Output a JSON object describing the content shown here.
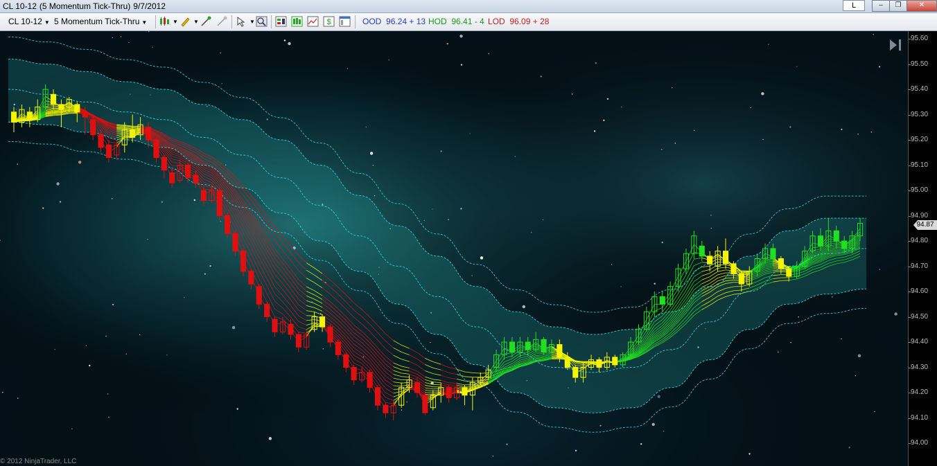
{
  "window": {
    "symbol": "CL 10-12",
    "period": "(5 Momentum Tick-Thru)",
    "date": "9/7/2012",
    "l_button": "L",
    "minimize": "–",
    "restore": "❐",
    "close": "✕"
  },
  "toolbar": {
    "instrument": "CL 10-12",
    "interval": "5 Momentum Tick-Thru",
    "ood_label": "OOD",
    "ood_value": "96.24 + 13",
    "hod_label": "HOD",
    "hod_value": "96.41 - 4",
    "lod_label": "LOD",
    "lod_value": "96.09 + 28",
    "colors": {
      "ood": "#1e3fd0",
      "hod": "#1a9a1a",
      "lod": "#d01a1a"
    }
  },
  "icons": [
    "bar-type-icon",
    "pencil-drawing-icon",
    "pin-tool-icon",
    "remove-tool-icon",
    "pointer-icon",
    "zoom-icon",
    "chart-trader-icon",
    "data-box-icon",
    "indicators-icon",
    "strategies-icon",
    "properties-icon",
    "scroll-end-icon"
  ],
  "price_axis": {
    "ticks": [
      "95.60",
      "95.50",
      "95.40",
      "95.30",
      "95.20",
      "95.10",
      "95.00",
      "94.90",
      "94.80",
      "94.70",
      "94.60",
      "94.50",
      "94.40",
      "94.30",
      "94.20",
      "94.10",
      "94.00"
    ],
    "last_price": "94.87"
  },
  "copyright": "© 2012 NinjaTrader, LLC",
  "chart_data": {
    "type": "candlestick",
    "ylim": [
      93.97,
      95.62
    ],
    "colors": {
      "up": "#20e020",
      "neutral": "#f5f500",
      "down": "#e01010",
      "band": "#30d0d8",
      "fill": "#208080"
    },
    "candles": [
      {
        "o": 95.31,
        "c": 95.27,
        "h": 95.33,
        "l": 95.23,
        "col": "neutral"
      },
      {
        "o": 95.27,
        "c": 95.32,
        "h": 95.34,
        "l": 95.25,
        "col": "neutral"
      },
      {
        "o": 95.31,
        "c": 95.28,
        "h": 95.33,
        "l": 95.25,
        "col": "neutral"
      },
      {
        "o": 95.28,
        "c": 95.33,
        "h": 95.36,
        "l": 95.27,
        "col": "neutral"
      },
      {
        "o": 95.33,
        "c": 95.4,
        "h": 95.42,
        "l": 95.32,
        "col": "up"
      },
      {
        "o": 95.38,
        "c": 95.34,
        "h": 95.4,
        "l": 95.32,
        "col": "neutral"
      },
      {
        "o": 95.34,
        "c": 95.32,
        "h": 95.36,
        "l": 95.25,
        "col": "neutral"
      },
      {
        "o": 95.33,
        "c": 95.36,
        "h": 95.37,
        "l": 95.31,
        "col": "neutral"
      },
      {
        "o": 95.34,
        "c": 95.31,
        "h": 95.35,
        "l": 95.27,
        "col": "neutral"
      },
      {
        "o": 95.31,
        "c": 95.29,
        "h": 95.33,
        "l": 95.22,
        "col": "down"
      },
      {
        "o": 95.28,
        "c": 95.22,
        "h": 95.3,
        "l": 95.2,
        "col": "down"
      },
      {
        "o": 95.22,
        "c": 95.17,
        "h": 95.24,
        "l": 95.15,
        "col": "down"
      },
      {
        "o": 95.18,
        "c": 95.13,
        "h": 95.2,
        "l": 95.11,
        "col": "down"
      },
      {
        "o": 95.14,
        "c": 95.18,
        "h": 95.2,
        "l": 95.12,
        "col": "down"
      },
      {
        "o": 95.18,
        "c": 95.24,
        "h": 95.27,
        "l": 95.15,
        "col": "neutral"
      },
      {
        "o": 95.24,
        "c": 95.21,
        "h": 95.3,
        "l": 95.19,
        "col": "neutral"
      },
      {
        "o": 95.22,
        "c": 95.26,
        "h": 95.29,
        "l": 95.2,
        "col": "neutral"
      },
      {
        "o": 95.25,
        "c": 95.2,
        "h": 95.27,
        "l": 95.17,
        "col": "down"
      },
      {
        "o": 95.2,
        "c": 95.13,
        "h": 95.21,
        "l": 95.11,
        "col": "down"
      },
      {
        "o": 95.13,
        "c": 95.08,
        "h": 95.14,
        "l": 95.05,
        "col": "down"
      },
      {
        "o": 95.07,
        "c": 95.03,
        "h": 95.09,
        "l": 95.01,
        "col": "down"
      },
      {
        "o": 95.04,
        "c": 95.1,
        "h": 95.12,
        "l": 95.03,
        "col": "down"
      },
      {
        "o": 95.1,
        "c": 95.05,
        "h": 95.11,
        "l": 95.03,
        "col": "down"
      },
      {
        "o": 95.06,
        "c": 95.03,
        "h": 95.08,
        "l": 95.01,
        "col": "down"
      },
      {
        "o": 95.0,
        "c": 94.96,
        "h": 95.02,
        "l": 94.94,
        "col": "down"
      },
      {
        "o": 94.96,
        "c": 95.0,
        "h": 95.02,
        "l": 94.95,
        "col": "down"
      },
      {
        "o": 95.0,
        "c": 94.9,
        "h": 95.01,
        "l": 94.88,
        "col": "down"
      },
      {
        "o": 94.9,
        "c": 94.83,
        "h": 94.91,
        "l": 94.81,
        "col": "down"
      },
      {
        "o": 94.83,
        "c": 94.76,
        "h": 94.84,
        "l": 94.74,
        "col": "down"
      },
      {
        "o": 94.76,
        "c": 94.68,
        "h": 94.77,
        "l": 94.66,
        "col": "down"
      },
      {
        "o": 94.68,
        "c": 94.63,
        "h": 94.69,
        "l": 94.61,
        "col": "down"
      },
      {
        "o": 94.62,
        "c": 94.55,
        "h": 94.63,
        "l": 94.53,
        "col": "down"
      },
      {
        "o": 94.55,
        "c": 94.5,
        "h": 94.56,
        "l": 94.48,
        "col": "down"
      },
      {
        "o": 94.49,
        "c": 94.44,
        "h": 94.5,
        "l": 94.42,
        "col": "down"
      },
      {
        "o": 94.44,
        "c": 94.48,
        "h": 94.5,
        "l": 94.43,
        "col": "down"
      },
      {
        "o": 94.47,
        "c": 94.43,
        "h": 94.49,
        "l": 94.41,
        "col": "down"
      },
      {
        "o": 94.43,
        "c": 94.38,
        "h": 94.44,
        "l": 94.36,
        "col": "down"
      },
      {
        "o": 94.38,
        "c": 94.43,
        "h": 94.45,
        "l": 94.37,
        "col": "down"
      },
      {
        "o": 94.45,
        "c": 94.5,
        "h": 94.52,
        "l": 94.44,
        "col": "neutral"
      },
      {
        "o": 94.5,
        "c": 94.46,
        "h": 94.51,
        "l": 94.44,
        "col": "neutral"
      },
      {
        "o": 94.46,
        "c": 94.4,
        "h": 94.47,
        "l": 94.38,
        "col": "down"
      },
      {
        "o": 94.4,
        "c": 94.35,
        "h": 94.41,
        "l": 94.33,
        "col": "down"
      },
      {
        "o": 94.35,
        "c": 94.3,
        "h": 94.36,
        "l": 94.28,
        "col": "down"
      },
      {
        "o": 94.3,
        "c": 94.25,
        "h": 94.31,
        "l": 94.23,
        "col": "down"
      },
      {
        "o": 94.25,
        "c": 94.28,
        "h": 94.3,
        "l": 94.24,
        "col": "down"
      },
      {
        "o": 94.28,
        "c": 94.22,
        "h": 94.29,
        "l": 94.2,
        "col": "down"
      },
      {
        "o": 94.22,
        "c": 94.15,
        "h": 94.23,
        "l": 94.13,
        "col": "down"
      },
      {
        "o": 94.15,
        "c": 94.12,
        "h": 94.16,
        "l": 94.1,
        "col": "down"
      },
      {
        "o": 94.12,
        "c": 94.15,
        "h": 94.17,
        "l": 94.09,
        "col": "down"
      },
      {
        "o": 94.15,
        "c": 94.22,
        "h": 94.24,
        "l": 94.14,
        "col": "neutral"
      },
      {
        "o": 94.22,
        "c": 94.25,
        "h": 94.27,
        "l": 94.2,
        "col": "neutral"
      },
      {
        "o": 94.24,
        "c": 94.2,
        "h": 94.26,
        "l": 94.18,
        "col": "down"
      },
      {
        "o": 94.19,
        "c": 94.12,
        "h": 94.2,
        "l": 94.11,
        "col": "down"
      },
      {
        "o": 94.14,
        "c": 94.19,
        "h": 94.21,
        "l": 94.13,
        "col": "neutral"
      },
      {
        "o": 94.19,
        "c": 94.22,
        "h": 94.24,
        "l": 94.16,
        "col": "neutral"
      },
      {
        "o": 94.22,
        "c": 94.18,
        "h": 94.23,
        "l": 94.16,
        "col": "down"
      },
      {
        "o": 94.18,
        "c": 94.22,
        "h": 94.24,
        "l": 94.17,
        "col": "down"
      },
      {
        "o": 94.22,
        "c": 94.19,
        "h": 94.23,
        "l": 94.15,
        "col": "neutral"
      },
      {
        "o": 94.19,
        "c": 94.24,
        "h": 94.26,
        "l": 94.13,
        "col": "neutral"
      },
      {
        "o": 94.24,
        "c": 94.26,
        "h": 94.28,
        "l": 94.23,
        "col": "neutral"
      },
      {
        "o": 94.26,
        "c": 94.29,
        "h": 94.31,
        "l": 94.25,
        "col": "neutral"
      },
      {
        "o": 94.3,
        "c": 94.35,
        "h": 94.37,
        "l": 94.28,
        "col": "up"
      },
      {
        "o": 94.35,
        "c": 94.4,
        "h": 94.42,
        "l": 94.33,
        "col": "up"
      },
      {
        "o": 94.4,
        "c": 94.36,
        "h": 94.42,
        "l": 94.34,
        "col": "up"
      },
      {
        "o": 94.36,
        "c": 94.4,
        "h": 94.42,
        "l": 94.34,
        "col": "up"
      },
      {
        "o": 94.4,
        "c": 94.37,
        "h": 94.42,
        "l": 94.35,
        "col": "up"
      },
      {
        "o": 94.37,
        "c": 94.41,
        "h": 94.44,
        "l": 94.36,
        "col": "up"
      },
      {
        "o": 94.41,
        "c": 94.36,
        "h": 94.42,
        "l": 94.35,
        "col": "up"
      },
      {
        "o": 94.36,
        "c": 94.39,
        "h": 94.41,
        "l": 94.35,
        "col": "up"
      },
      {
        "o": 94.39,
        "c": 94.34,
        "h": 94.41,
        "l": 94.32,
        "col": "neutral"
      },
      {
        "o": 94.34,
        "c": 94.3,
        "h": 94.36,
        "l": 94.29,
        "col": "neutral"
      },
      {
        "o": 94.3,
        "c": 94.26,
        "h": 94.31,
        "l": 94.24,
        "col": "neutral"
      },
      {
        "o": 94.26,
        "c": 94.3,
        "h": 94.32,
        "l": 94.24,
        "col": "neutral"
      },
      {
        "o": 94.3,
        "c": 94.33,
        "h": 94.35,
        "l": 94.29,
        "col": "neutral"
      },
      {
        "o": 94.33,
        "c": 94.3,
        "h": 94.34,
        "l": 94.28,
        "col": "neutral"
      },
      {
        "o": 94.3,
        "c": 94.34,
        "h": 94.36,
        "l": 94.29,
        "col": "neutral"
      },
      {
        "o": 94.34,
        "c": 94.31,
        "h": 94.35,
        "l": 94.3,
        "col": "neutral"
      },
      {
        "o": 94.31,
        "c": 94.35,
        "h": 94.36,
        "l": 94.3,
        "col": "up"
      },
      {
        "o": 94.35,
        "c": 94.4,
        "h": 94.42,
        "l": 94.34,
        "col": "up"
      },
      {
        "o": 94.4,
        "c": 94.45,
        "h": 94.47,
        "l": 94.39,
        "col": "up"
      },
      {
        "o": 94.45,
        "c": 94.52,
        "h": 94.54,
        "l": 94.44,
        "col": "up"
      },
      {
        "o": 94.52,
        "c": 94.58,
        "h": 94.6,
        "l": 94.5,
        "col": "up"
      },
      {
        "o": 94.58,
        "c": 94.55,
        "h": 94.6,
        "l": 94.52,
        "col": "up"
      },
      {
        "o": 94.55,
        "c": 94.62,
        "h": 94.64,
        "l": 94.54,
        "col": "up"
      },
      {
        "o": 94.62,
        "c": 94.69,
        "h": 94.71,
        "l": 94.6,
        "col": "up"
      },
      {
        "o": 94.69,
        "c": 94.75,
        "h": 94.77,
        "l": 94.67,
        "col": "up"
      },
      {
        "o": 94.75,
        "c": 94.82,
        "h": 94.84,
        "l": 94.73,
        "col": "up"
      },
      {
        "o": 94.78,
        "c": 94.74,
        "h": 94.8,
        "l": 94.72,
        "col": "up"
      },
      {
        "o": 94.74,
        "c": 94.71,
        "h": 94.76,
        "l": 94.68,
        "col": "neutral"
      },
      {
        "o": 94.7,
        "c": 94.76,
        "h": 94.78,
        "l": 94.68,
        "col": "neutral"
      },
      {
        "o": 94.76,
        "c": 94.71,
        "h": 94.81,
        "l": 94.69,
        "col": "neutral"
      },
      {
        "o": 94.71,
        "c": 94.67,
        "h": 94.72,
        "l": 94.65,
        "col": "neutral"
      },
      {
        "o": 94.67,
        "c": 94.63,
        "h": 94.68,
        "l": 94.6,
        "col": "neutral"
      },
      {
        "o": 94.63,
        "c": 94.68,
        "h": 94.7,
        "l": 94.62,
        "col": "neutral"
      },
      {
        "o": 94.68,
        "c": 94.73,
        "h": 94.75,
        "l": 94.66,
        "col": "up"
      },
      {
        "o": 94.73,
        "c": 94.77,
        "h": 94.79,
        "l": 94.71,
        "col": "up"
      },
      {
        "o": 94.77,
        "c": 94.73,
        "h": 94.79,
        "l": 94.7,
        "col": "up"
      },
      {
        "o": 94.73,
        "c": 94.69,
        "h": 94.74,
        "l": 94.67,
        "col": "neutral"
      },
      {
        "o": 94.69,
        "c": 94.66,
        "h": 94.7,
        "l": 94.64,
        "col": "neutral"
      },
      {
        "o": 94.66,
        "c": 94.7,
        "h": 94.72,
        "l": 94.65,
        "col": "up"
      },
      {
        "o": 94.7,
        "c": 94.76,
        "h": 94.78,
        "l": 94.69,
        "col": "up"
      },
      {
        "o": 94.76,
        "c": 94.82,
        "h": 94.84,
        "l": 94.75,
        "col": "up"
      },
      {
        "o": 94.82,
        "c": 94.78,
        "h": 94.85,
        "l": 94.76,
        "col": "up"
      },
      {
        "o": 94.78,
        "c": 94.84,
        "h": 94.89,
        "l": 94.76,
        "col": "up"
      },
      {
        "o": 94.84,
        "c": 94.8,
        "h": 94.86,
        "l": 94.77,
        "col": "up"
      },
      {
        "o": 94.8,
        "c": 94.77,
        "h": 94.82,
        "l": 94.75,
        "col": "up"
      },
      {
        "o": 94.77,
        "c": 94.82,
        "h": 94.84,
        "l": 94.75,
        "col": "up"
      },
      {
        "o": 94.82,
        "c": 94.87,
        "h": 94.89,
        "l": 94.8,
        "col": "up"
      }
    ],
    "band_upper": [
      95.52,
      95.5,
      95.47,
      95.43,
      95.4,
      95.34,
      95.28,
      95.2,
      95.1,
      94.98,
      94.86,
      94.74,
      94.62,
      94.52,
      94.46,
      94.43,
      94.45,
      94.52,
      94.62,
      94.74,
      94.84,
      94.89,
      94.89
    ],
    "band_mid": [
      95.4,
      95.38,
      95.35,
      95.31,
      95.28,
      95.21,
      95.14,
      95.05,
      94.94,
      94.82,
      94.7,
      94.58,
      94.46,
      94.36,
      94.3,
      94.28,
      94.3,
      94.37,
      94.48,
      94.6,
      94.7,
      94.75,
      94.77
    ],
    "band_lower": [
      95.27,
      95.26,
      95.23,
      95.2,
      95.17,
      95.1,
      95.01,
      94.91,
      94.8,
      94.68,
      94.55,
      94.43,
      94.31,
      94.2,
      94.14,
      94.12,
      94.14,
      94.22,
      94.33,
      94.45,
      94.55,
      94.59,
      94.61
    ]
  }
}
